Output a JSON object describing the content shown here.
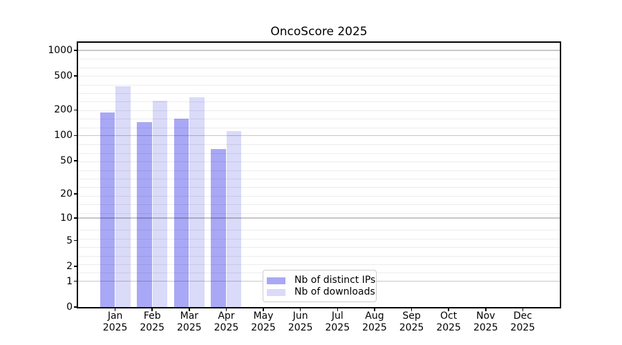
{
  "chart_data": {
    "type": "bar",
    "title": "OncoScore 2025",
    "xlabel": "",
    "ylabel": "",
    "yscale": "log10(1+y)",
    "ylim": [
      0,
      1230
    ],
    "grid": true,
    "legend_position": "lower-center",
    "yticks": [
      0,
      1,
      2,
      5,
      10,
      20,
      50,
      100,
      200,
      500,
      1000
    ],
    "ytick_labels": [
      "0",
      "1",
      "2",
      "5",
      "10",
      "20",
      "50",
      "100",
      "200",
      "500",
      "1000"
    ],
    "categories": [
      "Jan 2025",
      "Feb 2025",
      "Mar 2025",
      "Apr 2025",
      "May 2025",
      "Jun 2025",
      "Jul 2025",
      "Aug 2025",
      "Sep 2025",
      "Oct 2025",
      "Nov 2025",
      "Dec 2025"
    ],
    "series": [
      {
        "name": "Nb of distinct IPs",
        "color": "#a8a8f6",
        "values": [
          188,
          145,
          158,
          69,
          null,
          null,
          null,
          null,
          null,
          null,
          null,
          null
        ]
      },
      {
        "name": "Nb of downloads",
        "color": "#dadaf9",
        "values": [
          380,
          257,
          282,
          113,
          null,
          null,
          null,
          null,
          null,
          null,
          null,
          null
        ]
      }
    ]
  },
  "legend": {
    "items": [
      {
        "label": "Nb of distinct IPs",
        "color": "#a8a8f6"
      },
      {
        "label": "Nb of downloads",
        "color": "#dadaf9"
      }
    ]
  },
  "colors": {
    "bar_ips": "#a8a8f6",
    "bar_downloads": "#dadaf9",
    "axis": "#000000",
    "legend_border": "#cccccc",
    "background": "#ffffff"
  }
}
